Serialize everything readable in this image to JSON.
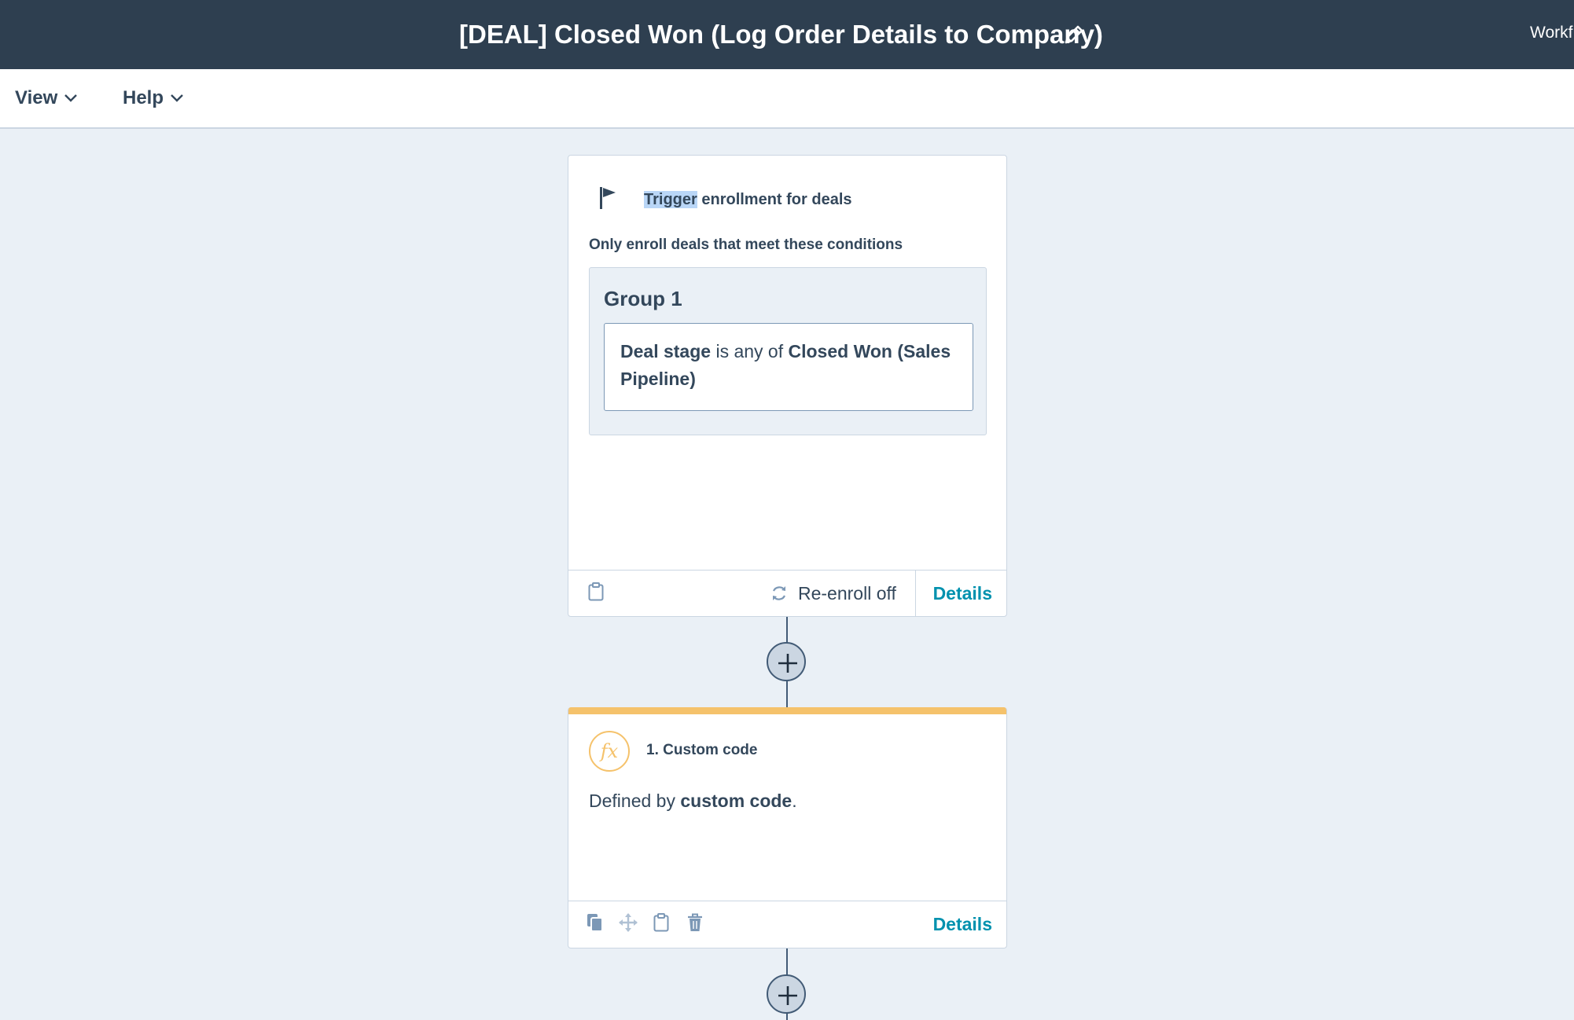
{
  "header": {
    "title": "[DEAL] Closed Won (Log Order Details to Company)",
    "edit_icon": "pencil-icon",
    "right_link": "Workf"
  },
  "toolbar": {
    "menus": [
      {
        "label": "View",
        "icon": "chevron-down-icon"
      },
      {
        "label": "Help",
        "icon": "chevron-down-icon"
      }
    ]
  },
  "trigger_card": {
    "icon": "flag-icon",
    "title_highlight": "Trigger",
    "title_rest": " enrollment for deals",
    "subtitle": "Only enroll deals that meet these conditions",
    "group": {
      "title": "Group 1",
      "condition": {
        "property": "Deal stage",
        "operator": " is any of ",
        "value": "Closed Won (Sales Pipeline)"
      }
    },
    "footer": {
      "clipboard_icon": "clipboard-icon",
      "reenroll_icon": "refresh-icon",
      "reenroll_label": "Re-enroll off",
      "details_label": "Details"
    }
  },
  "add_action_icon": "plus-icon",
  "action_card": {
    "accent_color": "#f5c26b",
    "icon": "fx-icon",
    "icon_text": "fx",
    "title": "1. Custom code",
    "description_prefix": "Defined by ",
    "description_bold": "custom code",
    "description_suffix": ".",
    "footer": {
      "icons": [
        "copy-icon",
        "move-icon",
        "clipboard-icon",
        "trash-icon"
      ],
      "details_label": "Details"
    }
  }
}
